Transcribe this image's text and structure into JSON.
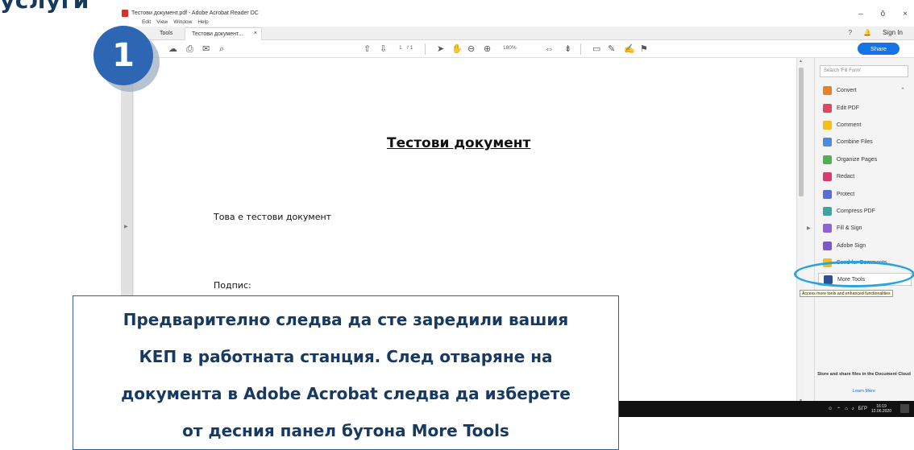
{
  "heading": "услуги",
  "window": {
    "title": "Тестови документ.pdf - Adobe Acrobat Reader DC",
    "controls": [
      "–",
      "ō",
      "×"
    ]
  },
  "menu": [
    "Edit",
    "View",
    "Window",
    "Help"
  ],
  "tabs": {
    "tools": "Tools",
    "document": "Тестови документ...",
    "close": "×"
  },
  "header_right": {
    "help_icon": "?",
    "bell_icon": "🔔",
    "sign_in": "Sign In"
  },
  "toolbar": {
    "page_current": "1",
    "page_total": "/ 1",
    "zoom": "180%",
    "share": "Share"
  },
  "document": {
    "title": "Тестови документ",
    "body": "Това е тестови документ",
    "signature_label": "Подпис:"
  },
  "tools_pane": {
    "search_placeholder": "Search 'Fill Form'",
    "items": [
      {
        "label": "Convert",
        "color": "#e5832c",
        "expanded": true
      },
      {
        "label": "Edit PDF",
        "color": "#e0475c"
      },
      {
        "label": "Comment",
        "color": "#f6bd16"
      },
      {
        "label": "Combine Files",
        "color": "#4a8bdc"
      },
      {
        "label": "Organize Pages",
        "color": "#4fb14f"
      },
      {
        "label": "Redact",
        "color": "#d83b72"
      },
      {
        "label": "Protect",
        "color": "#5a6fd6"
      },
      {
        "label": "Compress PDF",
        "color": "#3aa6a0"
      },
      {
        "label": "Fill & Sign",
        "color": "#8d62d1"
      },
      {
        "label": "Adobe Sign",
        "color": "#7d5bc4"
      },
      {
        "label": "Send for Comments",
        "color": "#f6bd16"
      },
      {
        "label": "More Tools",
        "color": "#2f4f8f"
      }
    ],
    "tooltip": "Access more tools and enhanced functionalities",
    "cloud_note": "Store and share files in the Document Cloud",
    "learn_more": "Learn More"
  },
  "taskbar": {
    "language": "БГР",
    "time": "16:19",
    "date": "12.06.2020"
  },
  "step_number": "1",
  "instruction": [
    "Предварително следва да сте заредили вашия",
    "КЕП в работната станция. След отваряне на",
    "документа в Adobe Acrobat следва да изберете",
    "от десния панел бутона More Tools"
  ]
}
